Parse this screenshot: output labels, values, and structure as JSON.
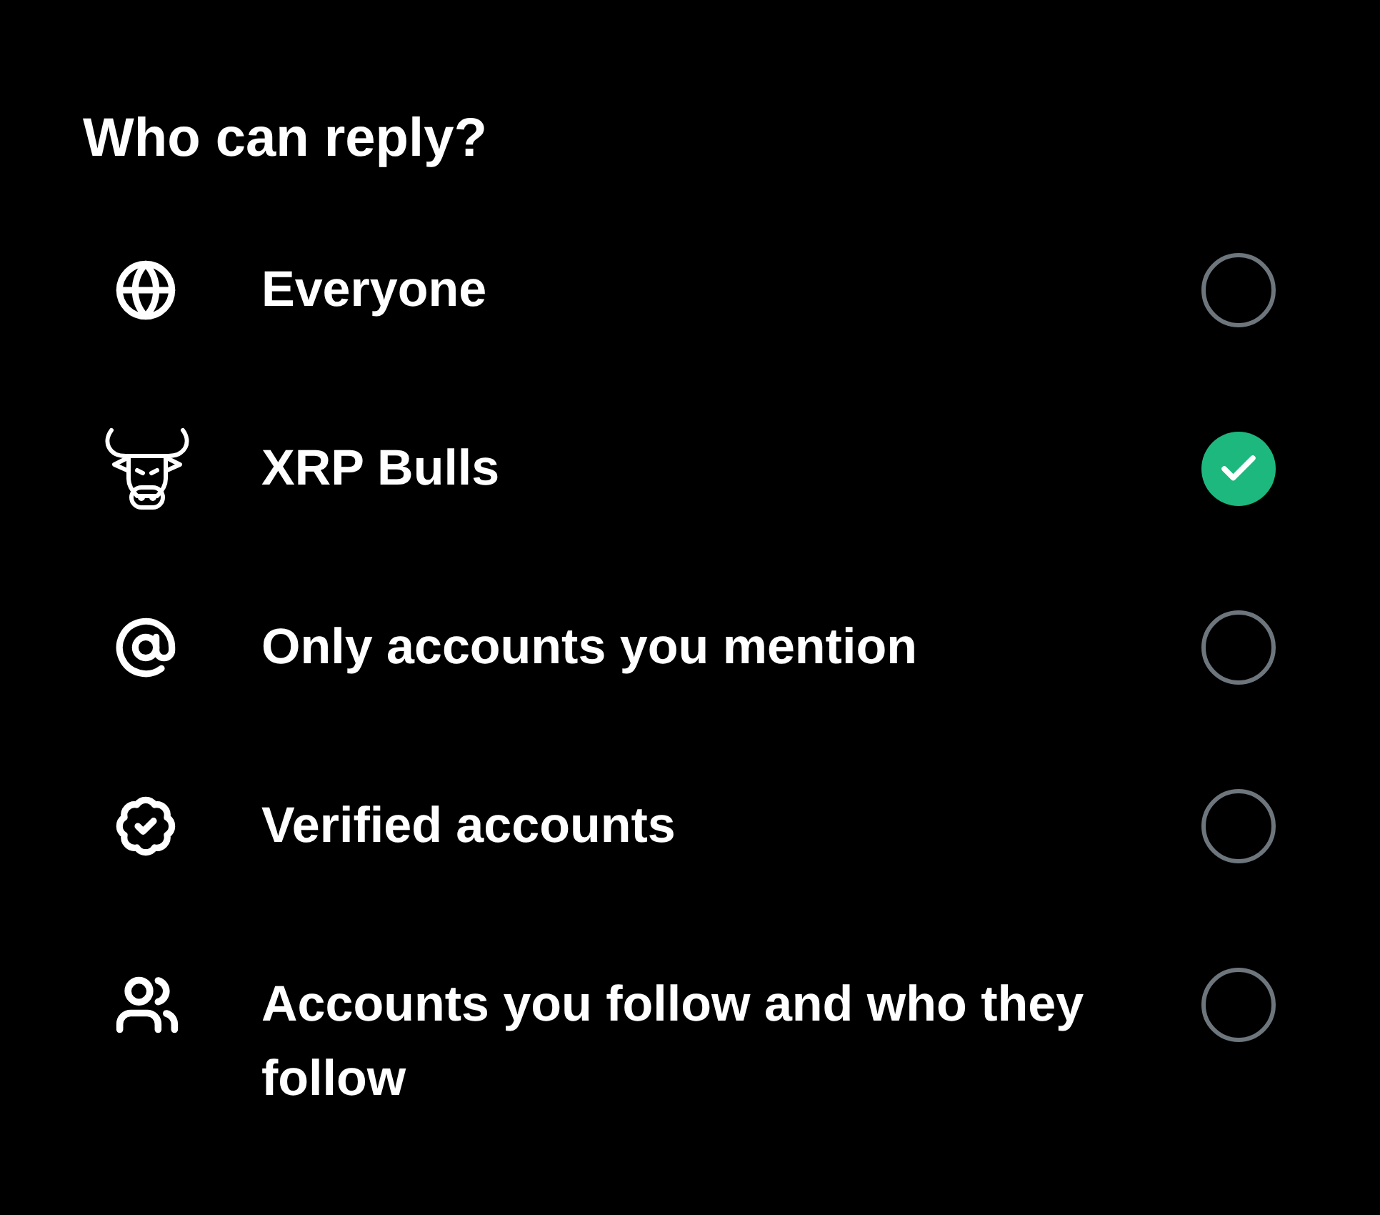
{
  "title": "Who can reply?",
  "options": [
    {
      "label": "Everyone",
      "selected": false
    },
    {
      "label": "XRP Bulls",
      "selected": true
    },
    {
      "label": "Only accounts you mention",
      "selected": false
    },
    {
      "label": "Verified accounts",
      "selected": false
    },
    {
      "label": "Accounts you follow and who they follow",
      "selected": false
    }
  ]
}
